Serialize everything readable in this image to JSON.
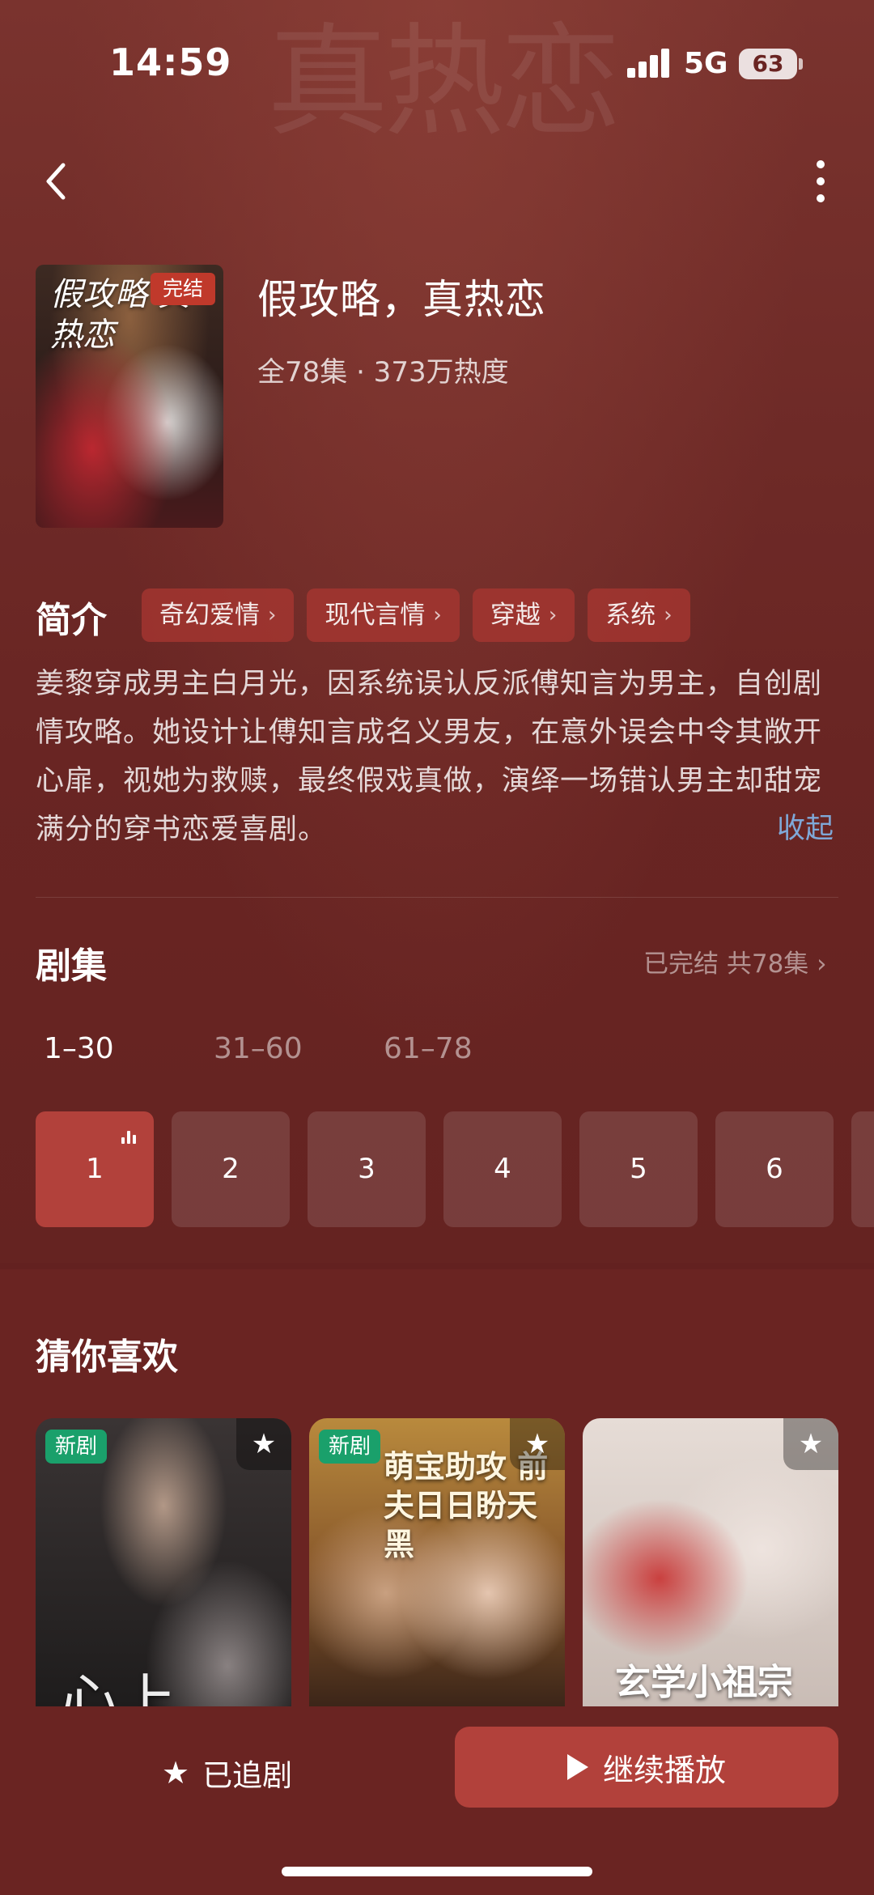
{
  "status_bar": {
    "time": "14:59",
    "network": "5G",
    "battery": "63"
  },
  "background_watermark": "真热恋",
  "header": {
    "back_icon": "chevron-left-icon",
    "more_icon": "more-vertical-icon"
  },
  "drama": {
    "poster_title": "假攻略 真热恋",
    "poster_badge": "完结",
    "title": "假攻略，真热恋",
    "meta": "全78集 · 373万热度"
  },
  "intro": {
    "label": "简介",
    "tags": [
      {
        "label": "奇幻爱情"
      },
      {
        "label": "现代言情"
      },
      {
        "label": "穿越"
      },
      {
        "label": "系统"
      }
    ],
    "description": "姜黎穿成男主白月光，因系统误认反派傅知言为男主，自创剧情攻略。她设计让傅知言成名义男友，在意外误会中令其敞开心扉，视她为救赎，最终假戏真做，演绎一场错认男主却甜宠满分的穿书恋爱喜剧。",
    "collapse_label": "收起"
  },
  "episodes": {
    "label": "剧集",
    "status": "已完结 共78集",
    "ranges": [
      "1–30",
      "31–60",
      "61–78"
    ],
    "active_range": 0,
    "items": [
      "1",
      "2",
      "3",
      "4",
      "5",
      "6"
    ],
    "active_episode": "1"
  },
  "recommend": {
    "label": "猜你喜欢",
    "cards": [
      {
        "badge": "新剧",
        "overlay": "心上"
      },
      {
        "badge": "新剧",
        "overlay": "萌宝助攻 前夫日日盼天黑"
      },
      {
        "badge": "",
        "overlay": "玄学小祖宗"
      }
    ]
  },
  "bottom": {
    "followed_label": "已追剧",
    "play_label": "继续播放"
  },
  "colors": {
    "background": "#6a2422",
    "accent": "#b2413b",
    "tag": "#aa3732",
    "new_badge": "#1aa06b",
    "link": "#7fa8d8"
  }
}
